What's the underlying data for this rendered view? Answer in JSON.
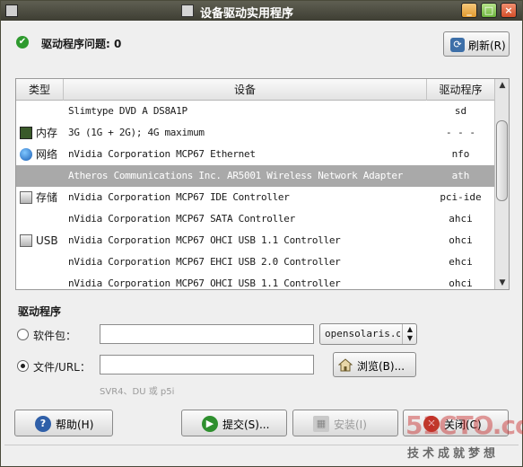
{
  "window": {
    "title": "设备驱动实用程序"
  },
  "status": {
    "text": "驱动程序问题: 0"
  },
  "refresh": {
    "label": "刷新(R)"
  },
  "table": {
    "headers": {
      "type": "类型",
      "device": "设备",
      "driver": "驱动程序"
    },
    "rows": [
      {
        "type": "",
        "icon": "",
        "device": "Slimtype DVD A DS8A1P",
        "driver": "sd",
        "selected": false
      },
      {
        "type": "内存",
        "icon": "memory-icon",
        "device": "3G (1G + 2G); 4G maximum",
        "driver": "- - -",
        "selected": false
      },
      {
        "type": "网络",
        "icon": "network-icon",
        "device": "nVidia Corporation MCP67 Ethernet",
        "driver": "nfo",
        "selected": false
      },
      {
        "type": "",
        "icon": "",
        "device": "Atheros Communications Inc. AR5001 Wireless Network Adapter",
        "driver": "ath",
        "selected": true
      },
      {
        "type": "存储",
        "icon": "storage-icon",
        "device": "nVidia Corporation MCP67 IDE Controller",
        "driver": "pci-ide",
        "selected": false
      },
      {
        "type": "",
        "icon": "",
        "device": "nVidia Corporation MCP67 SATA Controller",
        "driver": "ahci",
        "selected": false
      },
      {
        "type": "USB",
        "icon": "usb-icon",
        "device": "nVidia Corporation MCP67 OHCI USB 1.1 Controller",
        "driver": "ohci",
        "selected": false
      },
      {
        "type": "",
        "icon": "",
        "device": "nVidia Corporation MCP67 EHCI USB 2.0 Controller",
        "driver": "ehci",
        "selected": false
      },
      {
        "type": "",
        "icon": "",
        "device": "nVidia Corporation MCP67 OHCI USB 1.1 Controller",
        "driver": "ohci",
        "selected": false
      }
    ]
  },
  "driver_section": {
    "title": "驱动程序",
    "package_label": "软件包：",
    "package_value": "",
    "package_selected": false,
    "repo_value": "opensolaris.org",
    "file_label": "文件/URL：",
    "file_value": "",
    "file_selected": true,
    "browse_label": "浏览(B)...",
    "hint": "SVR4、DU 或 p5i"
  },
  "buttons": {
    "help": "帮助(H)",
    "submit": "提交(S)...",
    "install": "安装(I)",
    "close": "关闭(C)"
  },
  "watermark": {
    "logo": "51CTO.com",
    "sub": "技术成就梦想"
  },
  "colors": {
    "titlebar": "#4d4d42",
    "selection": "#a9a9a9",
    "ok_green": "#2f9a2f"
  }
}
